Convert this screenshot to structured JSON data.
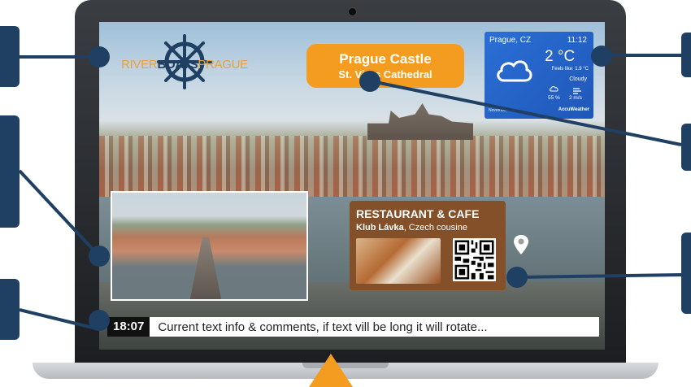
{
  "logo": {
    "word1": "RIVER",
    "word2": "BOATS",
    "word3": "PRAGUE"
  },
  "poi": {
    "title": "Prague Castle",
    "subtitle": "St. Vitus Cathedral"
  },
  "weather": {
    "city": "Prague, CZ",
    "time": "11:12",
    "temperature": "2 °C",
    "feels_like": "Feels like: 1.9 °C",
    "condition": "Cloudy",
    "humidity": "55 %",
    "wind": "2 m/s",
    "footer": "November",
    "brand": "AccuWeather"
  },
  "restaurant": {
    "title": "RESTAURANT & CAFE",
    "name": "Klub Lávka",
    "description": ", Czech cousine"
  },
  "ticker": {
    "time": "18:07",
    "text": "Current text info & comments, if text vill be long it will rotate..."
  },
  "colors": {
    "navy": "#1f3f63",
    "orange": "#f39c1f",
    "restaurant_brown": "#83502a",
    "weather_blue": "#2b6fd6"
  }
}
